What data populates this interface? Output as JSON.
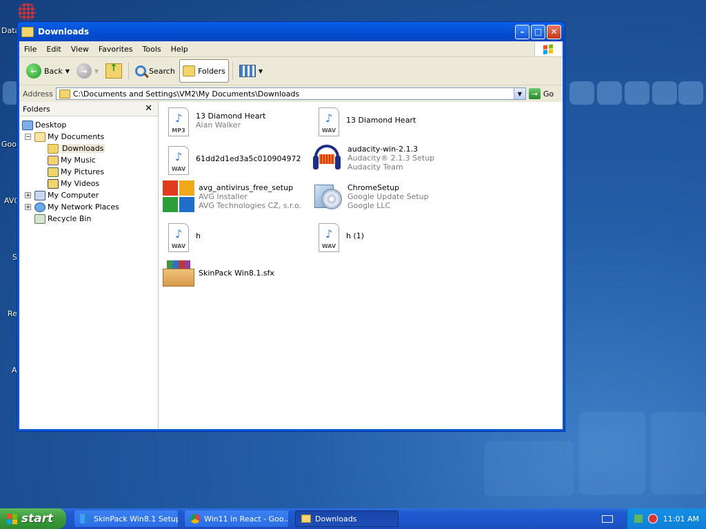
{
  "desktop": {
    "labels": [
      "Data",
      "Goo",
      "AVG",
      "S",
      "Re",
      "A"
    ]
  },
  "window": {
    "title": "Downloads",
    "controls": {
      "minimize": "–",
      "maximize": "□",
      "close": "✕"
    }
  },
  "menu": [
    "File",
    "Edit",
    "View",
    "Favorites",
    "Tools",
    "Help"
  ],
  "toolbar": {
    "back": "Back",
    "search": "Search",
    "folders": "Folders"
  },
  "address": {
    "label": "Address",
    "value": "C:\\Documents and Settings\\VM2\\My Documents\\Downloads",
    "go": "Go"
  },
  "folders_pane": {
    "title": "Folders",
    "close": "✕",
    "tree": [
      {
        "label": "Desktop"
      },
      {
        "label": "My Documents"
      },
      {
        "label": "Downloads",
        "selected": true
      },
      {
        "label": "My Music"
      },
      {
        "label": "My Pictures"
      },
      {
        "label": "My Videos"
      },
      {
        "label": "My Computer"
      },
      {
        "label": "My Network Places"
      },
      {
        "label": "Recycle Bin"
      }
    ]
  },
  "files": [
    {
      "name": "13 Diamond Heart",
      "sub1": "Alan Walker",
      "sub2": "",
      "icon": "mp3-icon",
      "ext": "MP3"
    },
    {
      "name": "13 Diamond Heart",
      "sub1": "",
      "sub2": "",
      "icon": "wav-icon",
      "ext": "WAV"
    },
    {
      "name": "61dd2d1ed3a5c010904972",
      "sub1": "",
      "sub2": "",
      "icon": "wav-icon",
      "ext": "WAV"
    },
    {
      "name": "audacity-win-2.1.3",
      "sub1": "Audacity® 2.1.3 Setup",
      "sub2": "Audacity Team",
      "icon": "audacity-icon"
    },
    {
      "name": "avg_antivirus_free_setup",
      "sub1": "AVG Installer",
      "sub2": "AVG Technologies CZ, s.r.o.",
      "icon": "avg-icon"
    },
    {
      "name": "ChromeSetup",
      "sub1": "Google Update Setup",
      "sub2": "Google LLC",
      "icon": "chrome-setup-icon"
    },
    {
      "name": "h",
      "sub1": "",
      "sub2": "",
      "icon": "wav-icon",
      "ext": "WAV"
    },
    {
      "name": "h (1)",
      "sub1": "",
      "sub2": "",
      "icon": "wav-icon",
      "ext": "WAV"
    },
    {
      "name": "SkinPack Win8.1.sfx",
      "sub1": "",
      "sub2": "",
      "icon": "archive-box-icon"
    }
  ],
  "taskbar": {
    "start": "start",
    "tasks": [
      "SkinPack Win8.1 Setup",
      "Win11 in React - Goo...",
      "Downloads"
    ],
    "clock": "11:01 AM"
  }
}
